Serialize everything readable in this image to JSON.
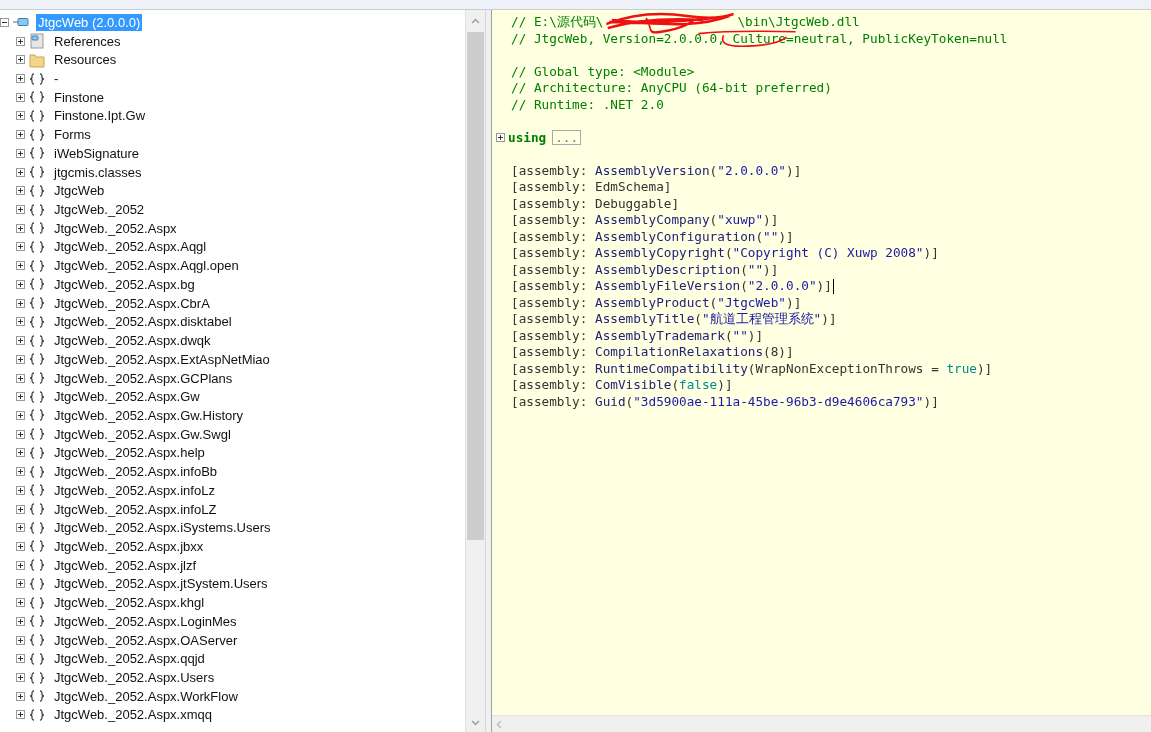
{
  "tree": {
    "root": {
      "label": "JtgcWeb (2.0.0.0)",
      "selected": true,
      "expanded": true,
      "kind": "assembly"
    },
    "children": [
      {
        "label": "References",
        "kind": "references",
        "expanded": false
      },
      {
        "label": "Resources",
        "kind": "folder",
        "expanded": false
      },
      {
        "label": "-",
        "kind": "namespace",
        "expanded": false
      },
      {
        "label": "Finstone",
        "kind": "namespace",
        "expanded": false
      },
      {
        "label": "Finstone.Ipt.Gw",
        "kind": "namespace",
        "expanded": false
      },
      {
        "label": "Forms",
        "kind": "namespace",
        "expanded": false
      },
      {
        "label": "iWebSignature",
        "kind": "namespace",
        "expanded": false
      },
      {
        "label": "jtgcmis.classes",
        "kind": "namespace",
        "expanded": false
      },
      {
        "label": "JtgcWeb",
        "kind": "namespace",
        "expanded": false
      },
      {
        "label": "JtgcWeb._2052",
        "kind": "namespace",
        "expanded": false
      },
      {
        "label": "JtgcWeb._2052.Aspx",
        "kind": "namespace",
        "expanded": false
      },
      {
        "label": "JtgcWeb._2052.Aspx.Aqgl",
        "kind": "namespace",
        "expanded": false
      },
      {
        "label": "JtgcWeb._2052.Aspx.Aqgl.open",
        "kind": "namespace",
        "expanded": false
      },
      {
        "label": "JtgcWeb._2052.Aspx.bg",
        "kind": "namespace",
        "expanded": false
      },
      {
        "label": "JtgcWeb._2052.Aspx.CbrA",
        "kind": "namespace",
        "expanded": false
      },
      {
        "label": "JtgcWeb._2052.Aspx.disktabel",
        "kind": "namespace",
        "expanded": false
      },
      {
        "label": "JtgcWeb._2052.Aspx.dwqk",
        "kind": "namespace",
        "expanded": false
      },
      {
        "label": "JtgcWeb._2052.Aspx.ExtAspNetMiao",
        "kind": "namespace",
        "expanded": false
      },
      {
        "label": "JtgcWeb._2052.Aspx.GCPlans",
        "kind": "namespace",
        "expanded": false
      },
      {
        "label": "JtgcWeb._2052.Aspx.Gw",
        "kind": "namespace",
        "expanded": false
      },
      {
        "label": "JtgcWeb._2052.Aspx.Gw.History",
        "kind": "namespace",
        "expanded": false
      },
      {
        "label": "JtgcWeb._2052.Aspx.Gw.Swgl",
        "kind": "namespace",
        "expanded": false
      },
      {
        "label": "JtgcWeb._2052.Aspx.help",
        "kind": "namespace",
        "expanded": false
      },
      {
        "label": "JtgcWeb._2052.Aspx.infoBb",
        "kind": "namespace",
        "expanded": false
      },
      {
        "label": "JtgcWeb._2052.Aspx.infoLz",
        "kind": "namespace",
        "expanded": false
      },
      {
        "label": "JtgcWeb._2052.Aspx.infoLZ",
        "kind": "namespace",
        "expanded": false
      },
      {
        "label": "JtgcWeb._2052.Aspx.iSystems.Users",
        "kind": "namespace",
        "expanded": false
      },
      {
        "label": "JtgcWeb._2052.Aspx.jbxx",
        "kind": "namespace",
        "expanded": false
      },
      {
        "label": "JtgcWeb._2052.Aspx.jlzf",
        "kind": "namespace",
        "expanded": false
      },
      {
        "label": "JtgcWeb._2052.Aspx.jtSystem.Users",
        "kind": "namespace",
        "expanded": false
      },
      {
        "label": "JtgcWeb._2052.Aspx.khgl",
        "kind": "namespace",
        "expanded": false
      },
      {
        "label": "JtgcWeb._2052.Aspx.LoginMes",
        "kind": "namespace",
        "expanded": false
      },
      {
        "label": "JtgcWeb._2052.Aspx.OAServer",
        "kind": "namespace",
        "expanded": false
      },
      {
        "label": "JtgcWeb._2052.Aspx.qqjd",
        "kind": "namespace",
        "expanded": false
      },
      {
        "label": "JtgcWeb._2052.Aspx.Users",
        "kind": "namespace",
        "expanded": false
      },
      {
        "label": "JtgcWeb._2052.Aspx.WorkFlow",
        "kind": "namespace",
        "expanded": false
      },
      {
        "label": "JtgcWeb._2052.Aspx.xmqq",
        "kind": "namespace",
        "expanded": false
      }
    ]
  },
  "code": [
    {
      "kind": "redacted",
      "before": "// E:\\源代码\\",
      "after": "\\bin\\JtgcWeb.dll"
    },
    {
      "kind": "comment",
      "text": "// JtgcWeb, Version=2.0.0.0, Culture=neutral, PublicKeyToken=null",
      "scribbled": true
    },
    {
      "kind": "blank"
    },
    {
      "kind": "comment",
      "text": "// Global type: <Module>"
    },
    {
      "kind": "comment",
      "text": "// Architecture: AnyCPU (64-bit preferred)"
    },
    {
      "kind": "comment",
      "text": "// Runtime: .NET 2.0"
    },
    {
      "kind": "blank"
    },
    {
      "kind": "using",
      "keyword": "using",
      "ellipsis": "...",
      "expanded": false
    },
    {
      "kind": "blank"
    },
    {
      "kind": "code",
      "tokens": [
        {
          "kind": "plain",
          "t": "[assembly: "
        },
        {
          "kind": "type",
          "t": "AssemblyVersion"
        },
        {
          "kind": "plain",
          "t": "("
        },
        {
          "kind": "string",
          "t": "\"2.0.0.0\""
        },
        {
          "kind": "plain",
          "t": ")]"
        }
      ]
    },
    {
      "kind": "code",
      "tokens": [
        {
          "kind": "plain",
          "t": "[assembly: EdmSchema]"
        }
      ]
    },
    {
      "kind": "code",
      "tokens": [
        {
          "kind": "plain",
          "t": "[assembly: Debuggable]"
        }
      ]
    },
    {
      "kind": "code",
      "tokens": [
        {
          "kind": "plain",
          "t": "[assembly: "
        },
        {
          "kind": "type",
          "t": "AssemblyCompany"
        },
        {
          "kind": "plain",
          "t": "("
        },
        {
          "kind": "string",
          "t": "\"xuwp\""
        },
        {
          "kind": "plain",
          "t": ")]"
        }
      ]
    },
    {
      "kind": "code",
      "tokens": [
        {
          "kind": "plain",
          "t": "[assembly: "
        },
        {
          "kind": "type",
          "t": "AssemblyConfiguration"
        },
        {
          "kind": "plain",
          "t": "("
        },
        {
          "kind": "string",
          "t": "\"\""
        },
        {
          "kind": "plain",
          "t": ")]"
        }
      ]
    },
    {
      "kind": "code",
      "tokens": [
        {
          "kind": "plain",
          "t": "[assembly: "
        },
        {
          "kind": "type",
          "t": "AssemblyCopyright"
        },
        {
          "kind": "plain",
          "t": "("
        },
        {
          "kind": "string",
          "t": "\"Copyright (C) Xuwp 2008\""
        },
        {
          "kind": "plain",
          "t": ")]"
        }
      ]
    },
    {
      "kind": "code",
      "tokens": [
        {
          "kind": "plain",
          "t": "[assembly: "
        },
        {
          "kind": "type",
          "t": "AssemblyDescription"
        },
        {
          "kind": "plain",
          "t": "("
        },
        {
          "kind": "string",
          "t": "\"\""
        },
        {
          "kind": "plain",
          "t": ")]"
        }
      ]
    },
    {
      "kind": "code",
      "cursor": true,
      "tokens": [
        {
          "kind": "plain",
          "t": "[assembly: "
        },
        {
          "kind": "type",
          "t": "AssemblyFileVersion"
        },
        {
          "kind": "plain",
          "t": "("
        },
        {
          "kind": "string",
          "t": "\"2.0.0.0\""
        },
        {
          "kind": "plain",
          "t": ")]"
        }
      ]
    },
    {
      "kind": "code",
      "tokens": [
        {
          "kind": "plain",
          "t": "[assembly: "
        },
        {
          "kind": "type",
          "t": "AssemblyProduct"
        },
        {
          "kind": "plain",
          "t": "("
        },
        {
          "kind": "string",
          "t": "\"JtgcWeb\""
        },
        {
          "kind": "plain",
          "t": ")]"
        }
      ]
    },
    {
      "kind": "code",
      "tokens": [
        {
          "kind": "plain",
          "t": "[assembly: "
        },
        {
          "kind": "type",
          "t": "AssemblyTitle"
        },
        {
          "kind": "plain",
          "t": "("
        },
        {
          "kind": "string",
          "t": "\"航道工程管理系统\""
        },
        {
          "kind": "plain",
          "t": ")]"
        }
      ]
    },
    {
      "kind": "code",
      "tokens": [
        {
          "kind": "plain",
          "t": "[assembly: "
        },
        {
          "kind": "type",
          "t": "AssemblyTrademark"
        },
        {
          "kind": "plain",
          "t": "("
        },
        {
          "kind": "string",
          "t": "\"\""
        },
        {
          "kind": "plain",
          "t": ")]"
        }
      ]
    },
    {
      "kind": "code",
      "tokens": [
        {
          "kind": "plain",
          "t": "[assembly: "
        },
        {
          "kind": "type",
          "t": "CompilationRelaxations"
        },
        {
          "kind": "plain",
          "t": "(8)]"
        }
      ]
    },
    {
      "kind": "code",
      "tokens": [
        {
          "kind": "plain",
          "t": "[assembly: "
        },
        {
          "kind": "type",
          "t": "RuntimeCompatibility"
        },
        {
          "kind": "plain",
          "t": "(WrapNonExceptionThrows = "
        },
        {
          "kind": "keyword",
          "t": "true"
        },
        {
          "kind": "plain",
          "t": ")]"
        }
      ]
    },
    {
      "kind": "code",
      "tokens": [
        {
          "kind": "plain",
          "t": "[assembly: "
        },
        {
          "kind": "type",
          "t": "ComVisible"
        },
        {
          "kind": "plain",
          "t": "("
        },
        {
          "kind": "keyword",
          "t": "false"
        },
        {
          "kind": "plain",
          "t": ")]"
        }
      ]
    },
    {
      "kind": "code",
      "tokens": [
        {
          "kind": "plain",
          "t": "[assembly: "
        },
        {
          "kind": "type",
          "t": "Guid"
        },
        {
          "kind": "plain",
          "t": "("
        },
        {
          "kind": "string",
          "t": "\"3d5900ae-111a-45be-96b3-d9e4606ca793\""
        },
        {
          "kind": "plain",
          "t": ")]"
        }
      ]
    }
  ]
}
